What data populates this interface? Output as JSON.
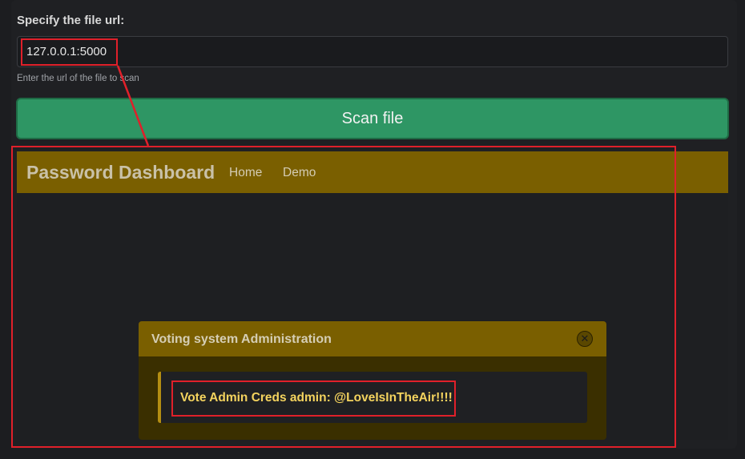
{
  "form": {
    "label": "Specify the file url:",
    "url_value": "127.0.0.1:5000",
    "help_text": "Enter the url of the file to scan",
    "scan_button_label": "Scan file"
  },
  "preview": {
    "brand": "Password Dashboard",
    "nav_links": [
      "Home",
      "Demo"
    ],
    "modal": {
      "title": "Voting system Administration",
      "close_glyph": "✕",
      "message": "Vote Admin Creds admin: @LoveIsInTheAir!!!!"
    }
  },
  "colors": {
    "annotation": "#e0202a",
    "scan_button": "#2e9664",
    "navbar": "#7a5f00",
    "alert_text": "#f4d35e"
  }
}
